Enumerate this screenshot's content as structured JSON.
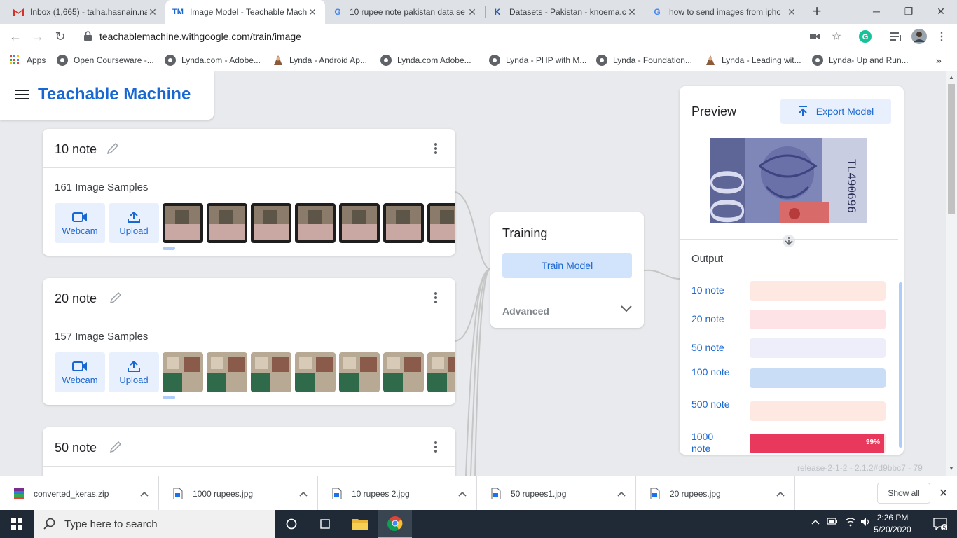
{
  "browser": {
    "tabs": [
      {
        "label": "Inbox (1,665) - talha.hasnain.na",
        "icon": "gmail-icon"
      },
      {
        "label": "Image Model - Teachable Mach",
        "icon": "teachable-machine-icon"
      },
      {
        "label": "10 rupee note pakistan data se",
        "icon": "google-icon"
      },
      {
        "label": "Datasets - Pakistan - knoema.c",
        "icon": "knoema-icon"
      },
      {
        "label": "how to send images from iphc",
        "icon": "google-icon"
      }
    ],
    "url": "teachablemachine.withgoogle.com/train/image",
    "bookmarks": [
      "Apps",
      "Open Courseware -...",
      "Lynda.com - Adobe...",
      "Lynda - Android Ap...",
      "Lynda.com Adobe...",
      "Lynda - PHP with M...",
      "Lynda - Foundation...",
      "Lynda - Leading wit...",
      "Lynda- Up and Run..."
    ]
  },
  "app": {
    "title": "Teachable Machine",
    "classes": [
      {
        "name": "10 note",
        "samples": "161 Image Samples",
        "webcam": "Webcam",
        "upload": "Upload"
      },
      {
        "name": "20 note",
        "samples": "157 Image Samples",
        "webcam": "Webcam",
        "upload": "Upload"
      },
      {
        "name": "50 note"
      }
    ],
    "training": {
      "title": "Training",
      "button": "Train Model",
      "advanced": "Advanced"
    },
    "preview": {
      "title": "Preview",
      "export": "Export Model",
      "output_title": "Output",
      "outputs": [
        {
          "label": "10 note",
          "value": 0.0,
          "color": "#fde9e1"
        },
        {
          "label": "20 note",
          "value": 0.0,
          "color": "#fde2e6"
        },
        {
          "label": "50 note",
          "value": 0.0,
          "color": "#eeeefb"
        },
        {
          "label": "100 note",
          "value": 0.0,
          "color": "#c9ddf7"
        },
        {
          "label": "500 note",
          "value": 0.0,
          "color": "#fde9e1"
        },
        {
          "label": "1000 note",
          "value": 0.99,
          "pct": "99%",
          "color": "#e8395c"
        }
      ]
    },
    "release": "release-2-1-2 - 2.1.2#d9bbc7 - 79"
  },
  "downloads": {
    "items": [
      "converted_keras.zip",
      "1000 rupees.jpg",
      "10 rupees 2.jpg",
      "50 rupees1.jpg",
      "20 rupees.jpg"
    ],
    "show_all": "Show all"
  },
  "taskbar": {
    "search_placeholder": "Type here to search",
    "time": "2:26 PM",
    "date": "5/20/2020",
    "notifications": "5"
  }
}
